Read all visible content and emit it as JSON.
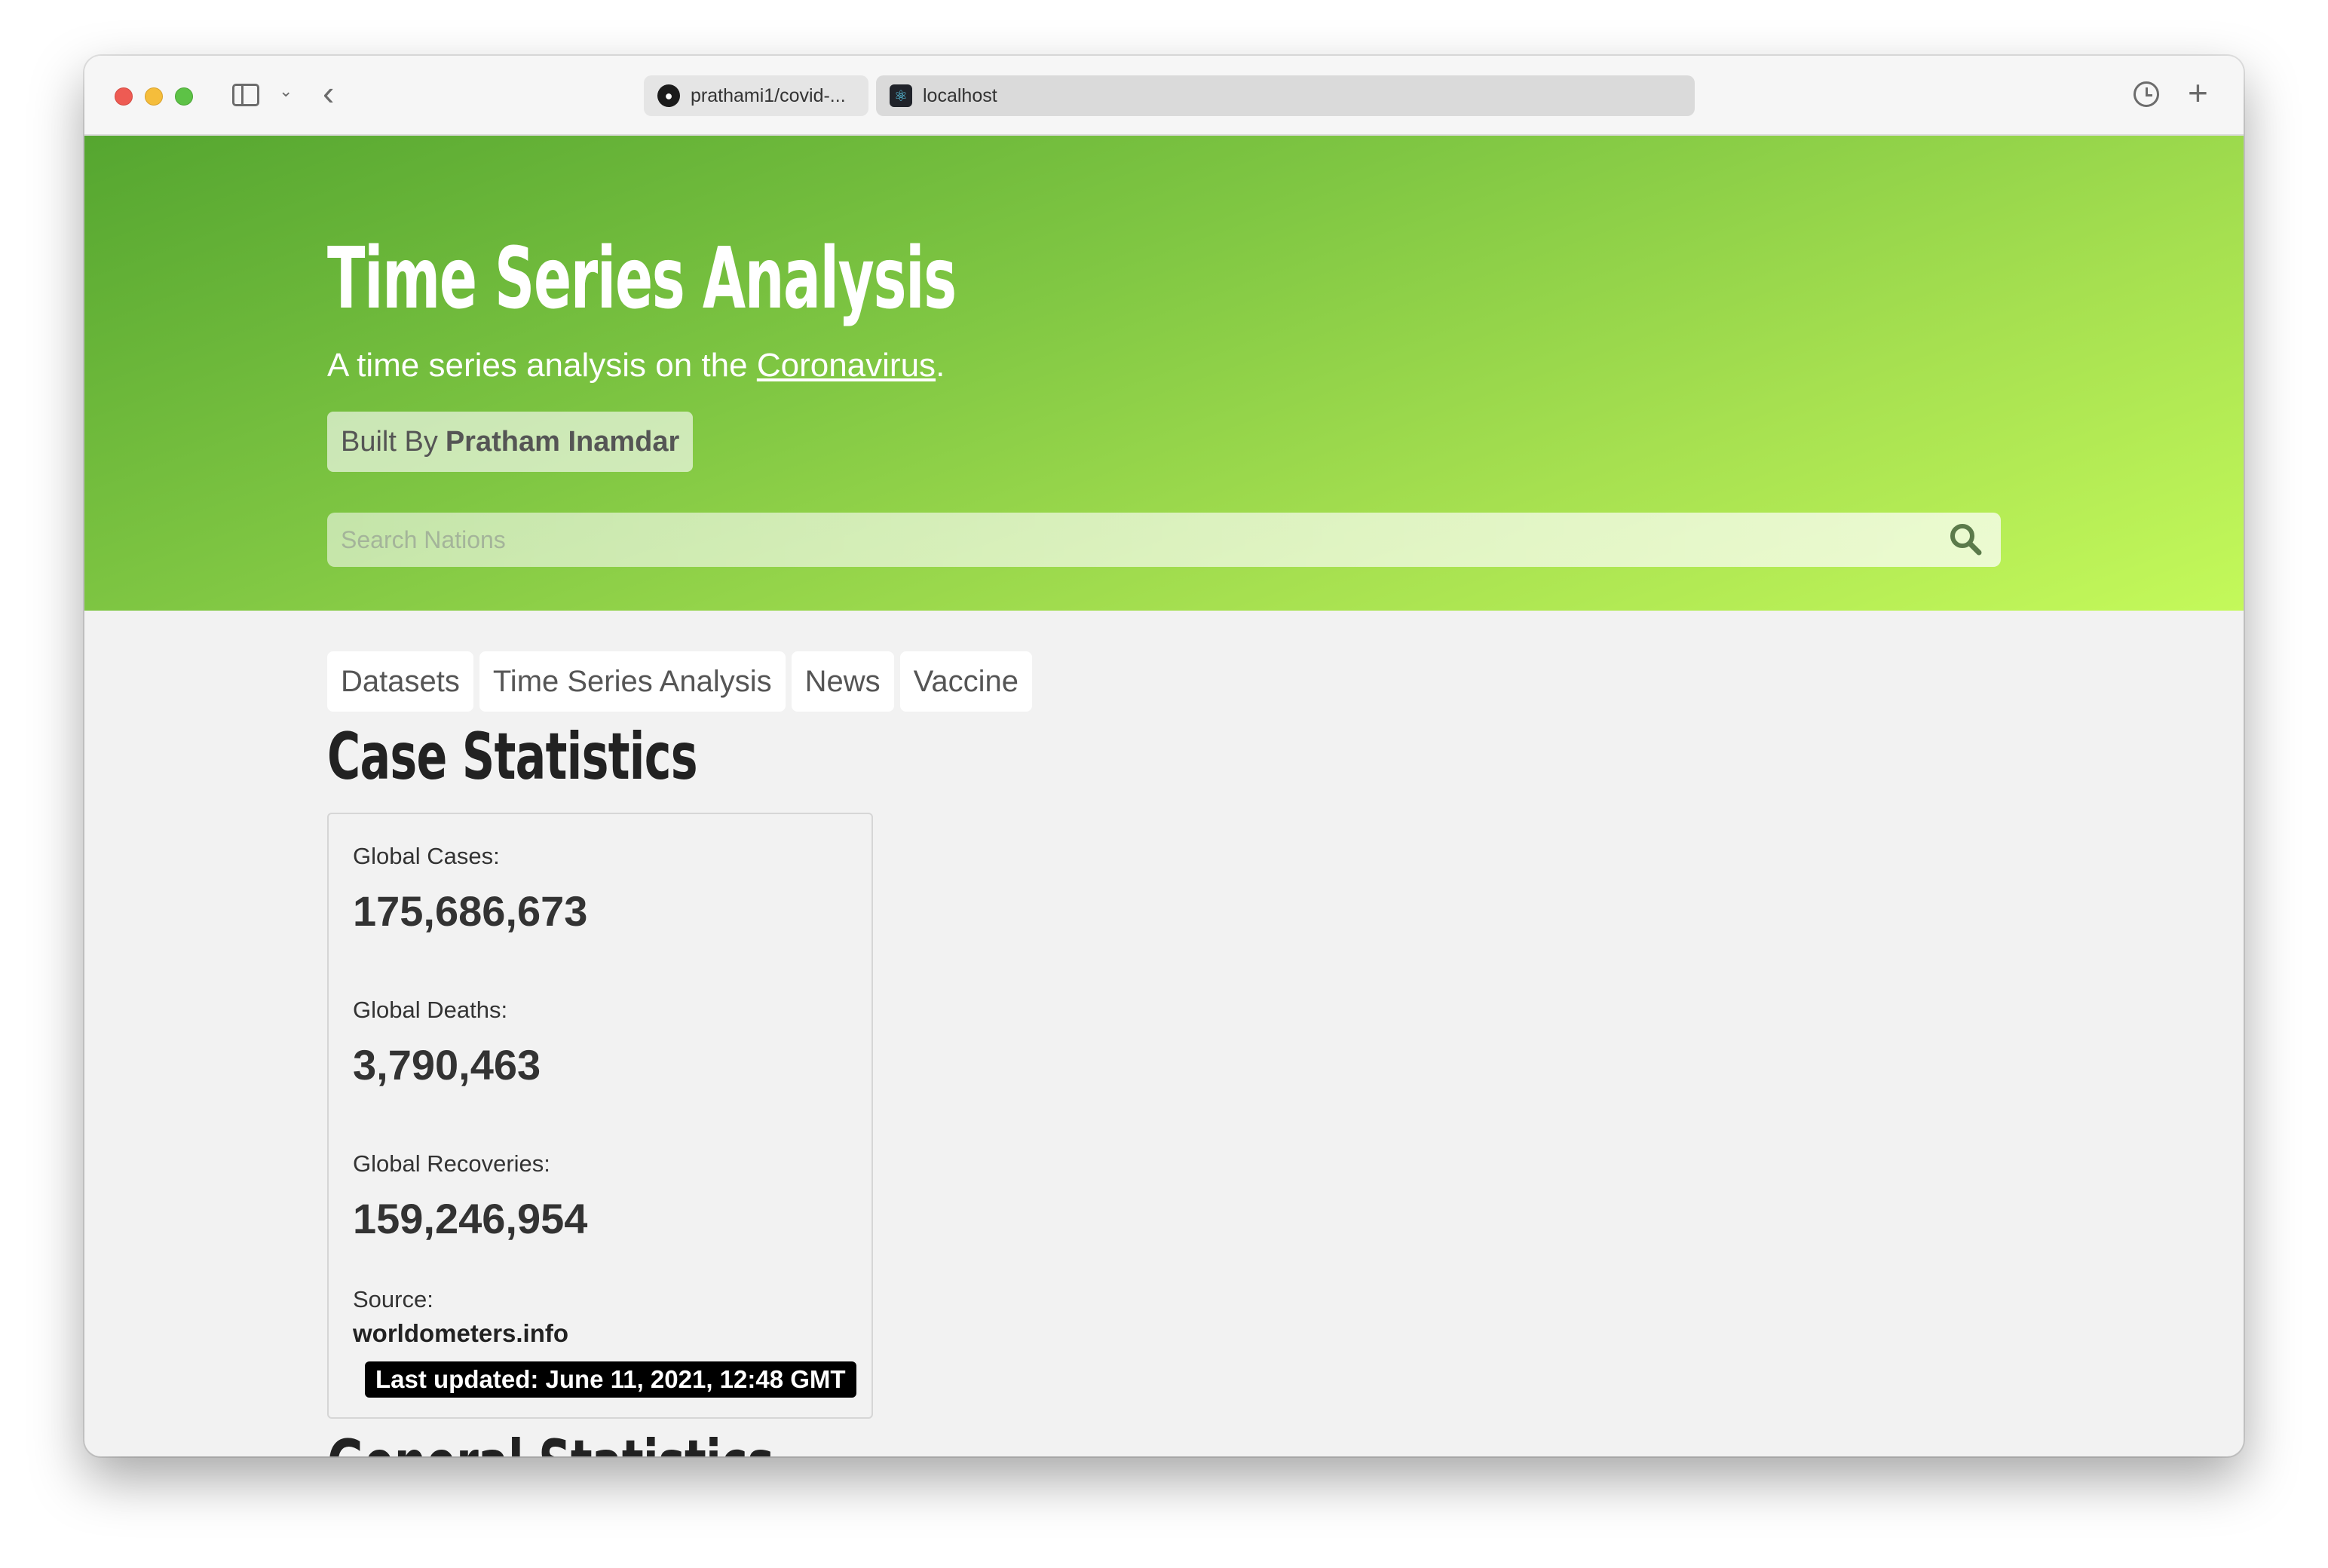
{
  "browser": {
    "tabs": [
      {
        "label": "prathami1/covid-...",
        "favicon": "github-icon"
      },
      {
        "label": "localhost",
        "favicon": "react-icon"
      }
    ]
  },
  "hero": {
    "title": "Time Series Analysis",
    "subtitle_prefix": "A time series analysis on the ",
    "subtitle_link": "Coronavirus",
    "subtitle_suffix": ".",
    "built_by_prefix": "Built By",
    "built_by_name": "Pratham Inamdar",
    "search_placeholder": "Search Nations",
    "gradient_start": "#55a630",
    "gradient_end": "#c4f95a"
  },
  "nav": {
    "tabs": [
      "Datasets",
      "Time Series Analysis",
      "News",
      "Vaccine"
    ]
  },
  "case_statistics": {
    "title": "Case Statistics",
    "global_cases_label": "Global Cases:",
    "global_cases_value": "175,686,673",
    "global_deaths_label": "Global Deaths:",
    "global_deaths_value": "3,790,463",
    "global_recoveries_label": "Global Recoveries:",
    "global_recoveries_value": "159,246,954",
    "source_label": "Source:",
    "source_value": "worldometers.info",
    "last_updated": "Last updated: June 11, 2021, 12:48 GMT"
  },
  "next_section": {
    "title": "General Statistics"
  }
}
